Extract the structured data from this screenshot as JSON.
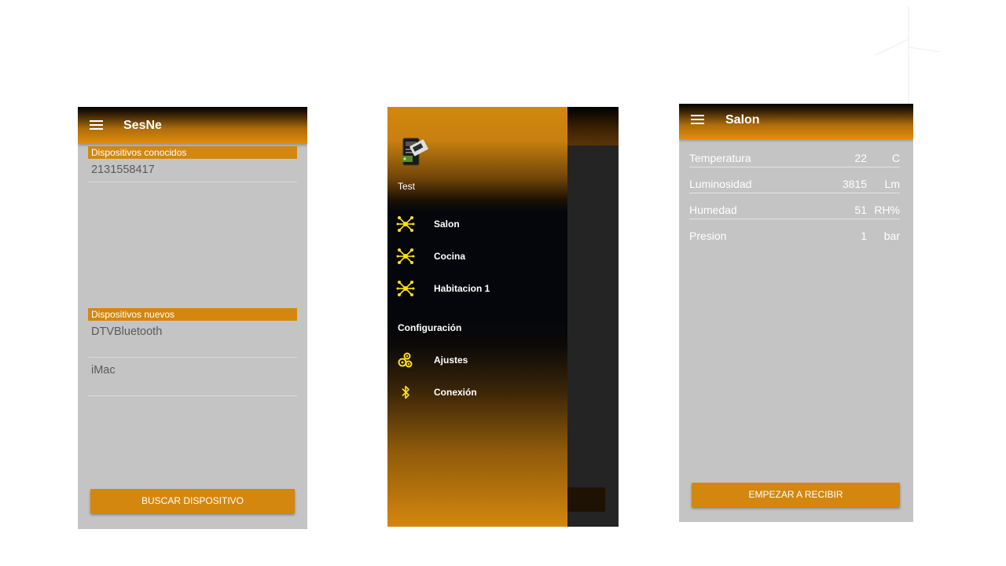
{
  "screen1": {
    "app_title": "SesNe",
    "known_header": "Dispositivos conocidos",
    "known_devices": [
      "2131558417"
    ],
    "new_header": "Dispositivos nuevos",
    "new_devices": [
      "DTVBluetooth",
      "iMac"
    ],
    "search_button": "BUSCAR DISPOSITIVO"
  },
  "screen2": {
    "user_name": "Test",
    "rooms": [
      {
        "label": "Salon",
        "icon": "hub-icon"
      },
      {
        "label": "Cocina",
        "icon": "hub-icon"
      },
      {
        "label": "Habitacion 1",
        "icon": "hub-icon"
      }
    ],
    "config_section": "Configuración",
    "config_items": [
      {
        "label": "Ajustes",
        "icon": "gears-icon"
      },
      {
        "label": "Conexión",
        "icon": "bluetooth-icon"
      }
    ]
  },
  "screen3": {
    "app_title": "Salon",
    "sensors": [
      {
        "name": "Temperatura",
        "value": "22",
        "unit": "C"
      },
      {
        "name": "Luminosidad",
        "value": "3815",
        "unit": "Lm"
      },
      {
        "name": "Humedad",
        "value": "51",
        "unit": "RH%"
      },
      {
        "name": "Presion",
        "value": "1",
        "unit": "bar"
      }
    ],
    "start_button": "EMPEZAR A RECIBIR"
  },
  "colors": {
    "accent": "#d4870e",
    "screen_bg": "#c4c4c4",
    "drawer_dark": "#04060b",
    "icon_yellow": "#ffe21a"
  }
}
